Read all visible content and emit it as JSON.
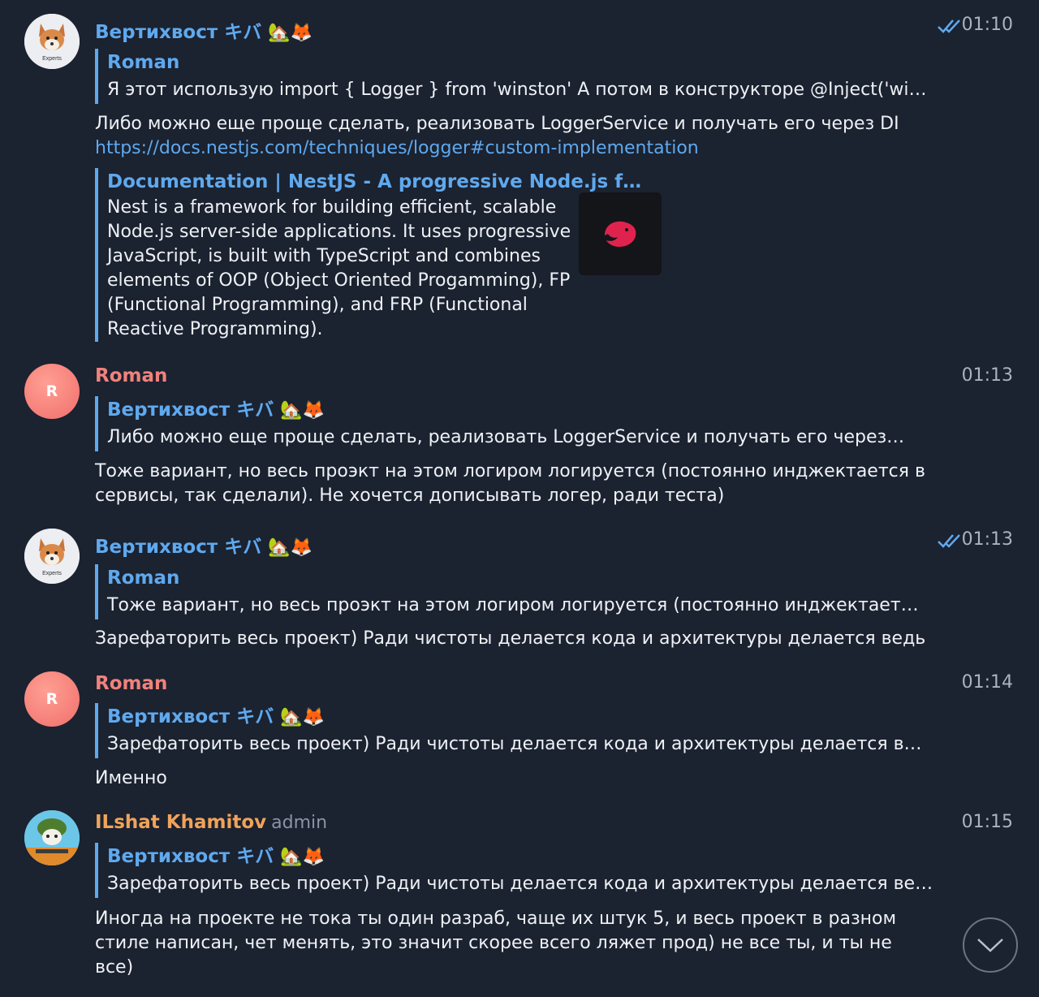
{
  "messages": [
    {
      "sender": "Вертихвост キバ",
      "sender_emoji": "🏡🦊",
      "time": "01:10",
      "reply": {
        "name": "Roman",
        "text": "Я этот использую import { Logger } from 'winston' А потом в конструкторе @Inject('wi…"
      },
      "text": "Либо можно еще проще сделать, реализовать LoggerService и получать его через DI",
      "link": "https://docs.nestjs.com/techniques/logger#custom-implementation",
      "preview": {
        "title": "Documentation | NestJS - A progressive Node.js f…",
        "description": "Nest is a framework for building efficient, scalable Node.js server-side applications. It uses progressive JavaScript, is built with TypeScript and combines elements of OOP (Object Oriented Progamming), FP (Functional Programming), and FRP (Functional Reactive Programming)."
      }
    },
    {
      "sender": "Roman",
      "avatar_letter": "R",
      "time": "01:13",
      "reply": {
        "name": "Вертихвост キバ",
        "emoji": "🏡🦊",
        "text": "Либо можно еще проще сделать, реализовать LoggerService и получать его через…"
      },
      "text": "Тоже вариант, но весь проэкт на этом логиром логируется (постоянно инджектается в сервисы, так сделали). Не хочется дописывать логер, ради теста)"
    },
    {
      "sender": "Вертихвост キバ",
      "sender_emoji": "🏡🦊",
      "time": "01:13",
      "reply": {
        "name": "Roman",
        "text": "Тоже вариант, но весь проэкт на этом логиром логируется (постоянно инджектает…"
      },
      "text": "Зарефаторить весь проект) Ради чистоты делается кода и архитектуры делается ведь"
    },
    {
      "sender": "Roman",
      "avatar_letter": "R",
      "time": "01:14",
      "reply": {
        "name": "Вертихвост キバ",
        "emoji": "🏡🦊",
        "text": "Зарефаторить весь проект) Ради чистоты делается кода и архитектуры делается в…"
      },
      "text": "Именно"
    },
    {
      "sender": "ILshat Khamitov",
      "role": "admin",
      "time": "01:15",
      "reply": {
        "name": "Вертихвост キバ",
        "emoji": "🏡🦊",
        "text": "Зарефаторить весь проект) Ради чистоты делается кода и архитектуры делается ве…"
      },
      "text": "Иногда на проекте не тока ты один разраб, чаще их штук 5, и весь проект в разном стиле написан, чет менять, это значит скорее всего ляжет прод) не все ты, и ты не все)"
    }
  ],
  "avatar_caption": "Experts",
  "colors": {
    "background": "#1b2230",
    "accent": "#5fa9ee",
    "roman": "#f1827c",
    "admin_name": "#f0a35a"
  },
  "icons": {
    "read_receipt": "double-check-icon",
    "scroll_down": "chevron-down-icon"
  }
}
